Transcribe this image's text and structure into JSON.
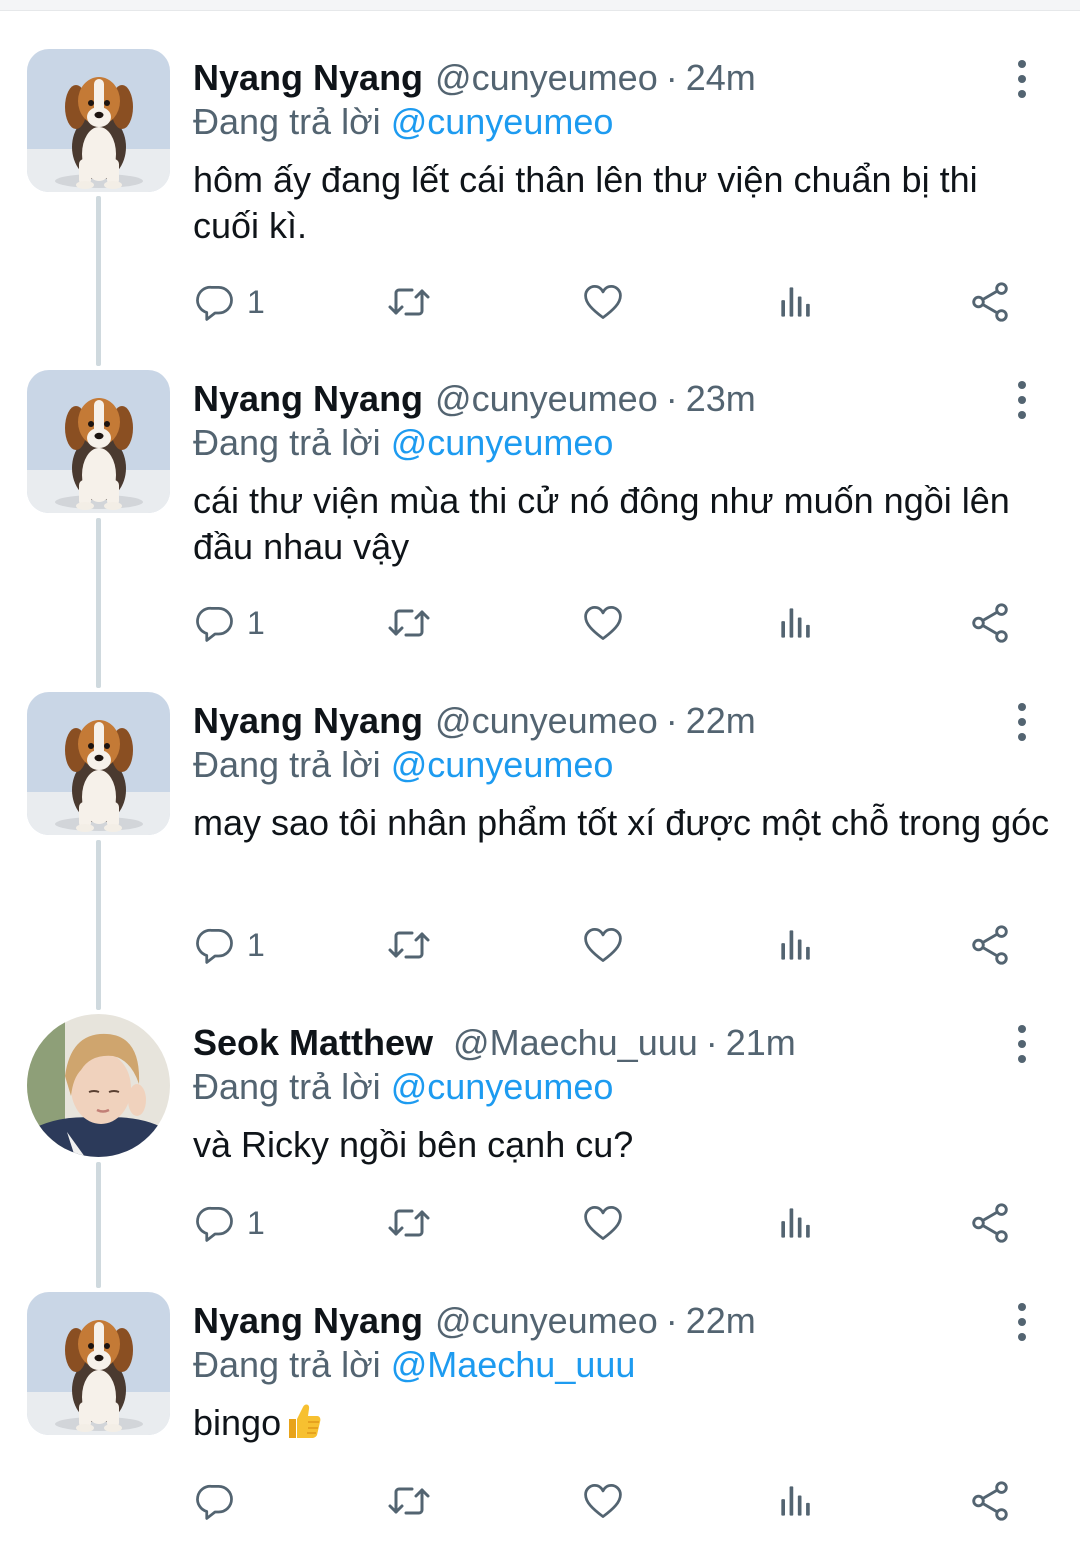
{
  "icons": {
    "reply": "reply-icon",
    "retweet": "retweet-icon",
    "like": "heart-icon",
    "views": "views-icon",
    "share": "share-icon",
    "more": "more-icon"
  },
  "colors": {
    "link": "#1d9bf0",
    "secondary": "#536471",
    "thread_line": "#cfd9de"
  },
  "tweets": [
    {
      "name": "Nyang Nyang",
      "handle": "@cunyeumeo",
      "dot": "·",
      "time": "24m",
      "reply_lead": "Đang trả lời",
      "reply_to": "@cunyeumeo",
      "text": "hôm ấy đang lết cái thân lên thư viện chuẩn bị thi cuối kì.",
      "reply_count": "1",
      "avatar": "beagle-puppy"
    },
    {
      "name": "Nyang Nyang",
      "handle": "@cunyeumeo",
      "dot": "·",
      "time": "23m",
      "reply_lead": "Đang trả lời",
      "reply_to": "@cunyeumeo",
      "text": "cái thư viện mùa thi cử nó đông như muốn ngồi lên đầu nhau vậy",
      "reply_count": "1",
      "avatar": "beagle-puppy"
    },
    {
      "name": "Nyang Nyang",
      "handle": "@cunyeumeo",
      "dot": "·",
      "time": "22m",
      "reply_lead": "Đang trả lời",
      "reply_to": "@cunyeumeo",
      "text": "may sao tôi nhân phẩm tốt xí được một chỗ trong góc",
      "reply_count": "1",
      "avatar": "beagle-puppy"
    },
    {
      "name": "Seok Matthew",
      "handle": "@Maechu_uuu",
      "dot": "·",
      "time": "21m",
      "reply_lead": "Đang trả lời",
      "reply_to": "@cunyeumeo",
      "text": "và Ricky ngồi bên cạnh cu?",
      "reply_count": "1",
      "avatar": "person-photo"
    },
    {
      "name": "Nyang Nyang",
      "handle": "@cunyeumeo",
      "dot": "·",
      "time": "22m",
      "reply_lead": "Đang trả lời",
      "reply_to": "@Maechu_uuu",
      "text": "bingo",
      "emoji": "👍",
      "reply_count": "",
      "avatar": "beagle-puppy"
    }
  ]
}
